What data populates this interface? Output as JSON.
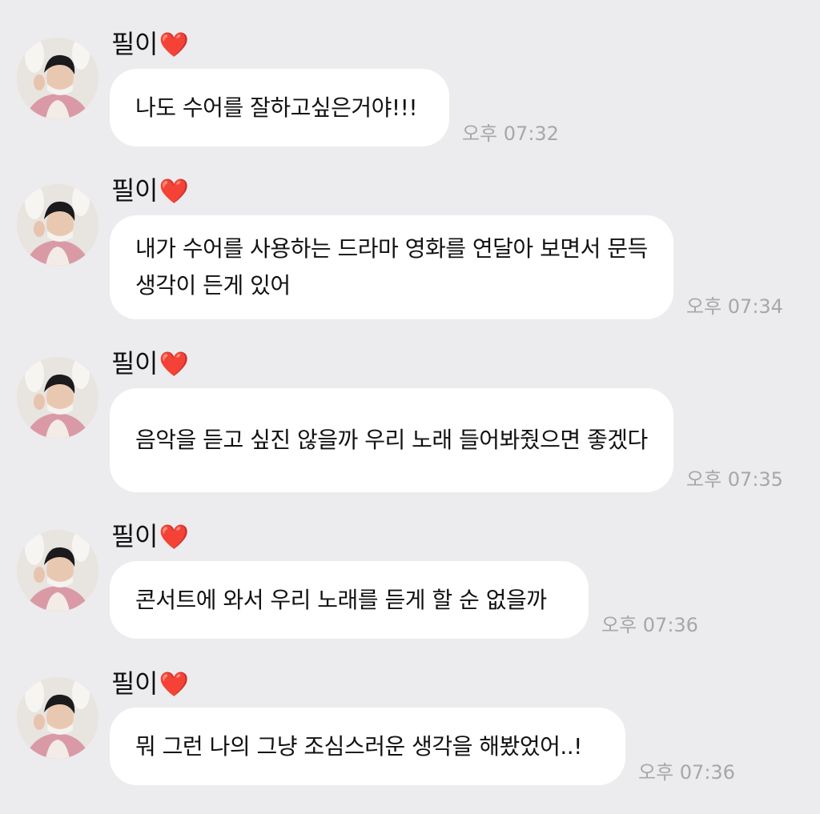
{
  "messages": [
    {
      "sender": "필이",
      "sender_emoji": "❤️",
      "text": "나도 수어를 잘하고싶은거야!!!",
      "time": "오후 07:32"
    },
    {
      "sender": "필이",
      "sender_emoji": "❤️",
      "text": "내가 수어를 사용하는 드라마 영화를 연달아 보면서 문득 생각이 든게 있어",
      "time": "오후 07:34"
    },
    {
      "sender": "필이",
      "sender_emoji": "❤️",
      "text": "음악을 듣고 싶진 않을까 우리 노래 들어봐줬으면 좋겠다",
      "time": "오후 07:35"
    },
    {
      "sender": "필이",
      "sender_emoji": "❤️",
      "text": "콘서트에 와서 우리 노래를 듣게 할 순 없을까",
      "time": "오후 07:36"
    },
    {
      "sender": "필이",
      "sender_emoji": "❤️",
      "text": "뭐 그런 나의 그냥 조심스러운 생각을 해봤었어..!",
      "time": "오후 07:36"
    }
  ],
  "colors": {
    "background": "#ececee",
    "bubble": "#ffffff",
    "timestamp": "#a7a7aa",
    "heart": "#e0192b"
  }
}
